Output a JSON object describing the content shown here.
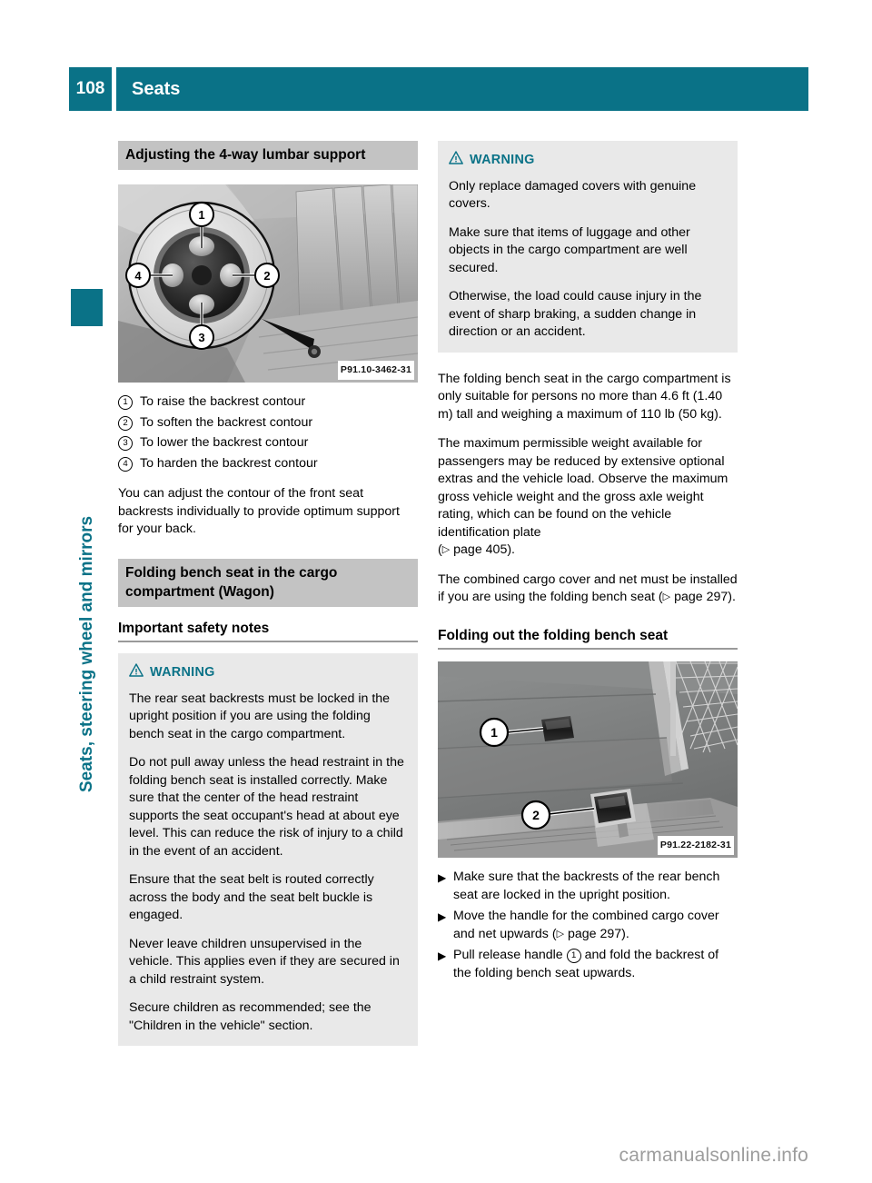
{
  "header": {
    "page_number": "108",
    "title": "Seats"
  },
  "sidebar": {
    "chapter_label": "Seats, steering wheel and mirrors"
  },
  "theme": {
    "accent": "#0a7287",
    "heading_band": "#c3c3c3",
    "warning_bg": "#e9e9e9",
    "rule": "#9a9a9a"
  },
  "left_column": {
    "heading": "Adjusting the 4-way lumbar support",
    "figure": {
      "name": "lumbar-support-switch-photo",
      "caption": "P91.10-3462-31",
      "callouts": [
        "1",
        "2",
        "3",
        "4"
      ]
    },
    "legend": [
      {
        "marker": "1",
        "text": "To raise the backrest contour"
      },
      {
        "marker": "2",
        "text": "To soften the backrest contour"
      },
      {
        "marker": "3",
        "text": "To lower the backrest contour"
      },
      {
        "marker": "4",
        "text": "To harden the backrest contour"
      }
    ],
    "body": "You can adjust the contour of the front seat backrests individually to provide optimum support for your back.",
    "section_heading": "Folding bench seat in the cargo compartment (Wagon)",
    "sub_heading": "Important safety notes",
    "warning": {
      "icon": "warning-triangle-icon",
      "label": "WARNING",
      "paragraphs": [
        "The rear seat backrests must be locked in the upright position if you are using the folding bench seat in the cargo compartment.",
        "Do not pull away unless the head restraint in the folding bench seat is installed correctly. Make sure that the center of the head restraint supports the seat occupant's head at about eye level. This can reduce the risk of injury to a child in the event of an accident.",
        "Ensure that the seat belt is routed correctly across the body and the seat belt buckle is engaged.",
        "Never leave children unsupervised in the vehicle. This applies even if they are secured in a child restraint system.",
        "Secure children as recommended; see the \"Children in the vehicle\" section."
      ]
    }
  },
  "right_column": {
    "warning": {
      "icon": "warning-triangle-icon",
      "label": "WARNING",
      "paragraphs": [
        "Only replace damaged covers with genuine covers.",
        "Make sure that items of luggage and other objects in the cargo compartment are well secured.",
        "Otherwise, the load could cause injury in the event of sharp braking, a sudden change in direction or an accident."
      ]
    },
    "body_paragraphs": [
      "The folding bench seat in the cargo compartment is only suitable for persons no more than 4.6 ft (1.40 m) tall and weighing a maximum of 110 lb (50 kg).",
      "The maximum permissible weight available for passengers may be reduced by extensive optional extras and the vehicle load. Observe the maximum gross vehicle weight and the gross axle weight rating, which can be found on the vehicle identification plate"
    ],
    "page_ref_1": "page 405).",
    "body_paragraph_3_a": "The combined cargo cover and net must be installed if you are using the folding bench seat (",
    "page_ref_2": "page 297).",
    "section_heading": "Folding out the folding bench seat",
    "figure": {
      "name": "cargo-compartment-handles-photo",
      "caption": "P91.22-2182-31",
      "callouts": [
        "1",
        "2"
      ]
    },
    "steps": [
      {
        "bullet": "▶",
        "text": "Make sure that the backrests of the rear bench seat are locked in the upright position."
      },
      {
        "bullet": "▶",
        "text_a": "Move the handle for the combined cargo cover and net upwards (",
        "page_ref": "page 297)."
      },
      {
        "bullet": "▶",
        "text_a": "Pull release handle",
        "callout": "1",
        "text_b": "and fold the backrest of the folding bench seat upwards."
      }
    ]
  },
  "footer": {
    "watermark": "carmanualsonline.info"
  }
}
